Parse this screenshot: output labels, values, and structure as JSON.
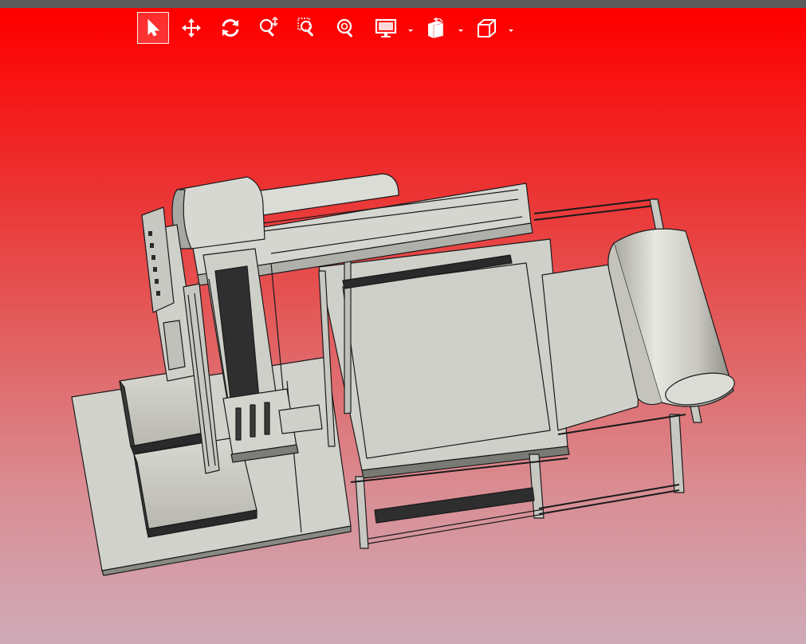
{
  "app": {
    "window_title": "",
    "theme": {
      "background_top": "#ff0000",
      "background_bottom": "#cfaab8",
      "toolbar_icon_color": "#ffffff",
      "model_color": "#d2d2cc"
    }
  },
  "toolbar": {
    "tools": [
      {
        "id": "select",
        "icon": "select-arrow-icon",
        "active": true
      },
      {
        "id": "pan",
        "icon": "pan-move-icon",
        "active": false
      },
      {
        "id": "rotate",
        "icon": "rotate-icon",
        "active": false
      },
      {
        "id": "zoom",
        "icon": "zoom-icon",
        "active": false
      },
      {
        "id": "zoom-window",
        "icon": "zoom-window-icon",
        "active": false
      },
      {
        "id": "zoom-fit",
        "icon": "zoom-fit-icon",
        "active": false
      },
      {
        "id": "display-style",
        "icon": "monitor-icon",
        "has_dropdown": true
      },
      {
        "id": "section-view",
        "icon": "section-view-icon",
        "has_dropdown": true
      },
      {
        "id": "standard-views",
        "icon": "cube-view-icon",
        "has_dropdown": true
      }
    ]
  },
  "viewport": {
    "model": "industrial-machine-assembly"
  }
}
